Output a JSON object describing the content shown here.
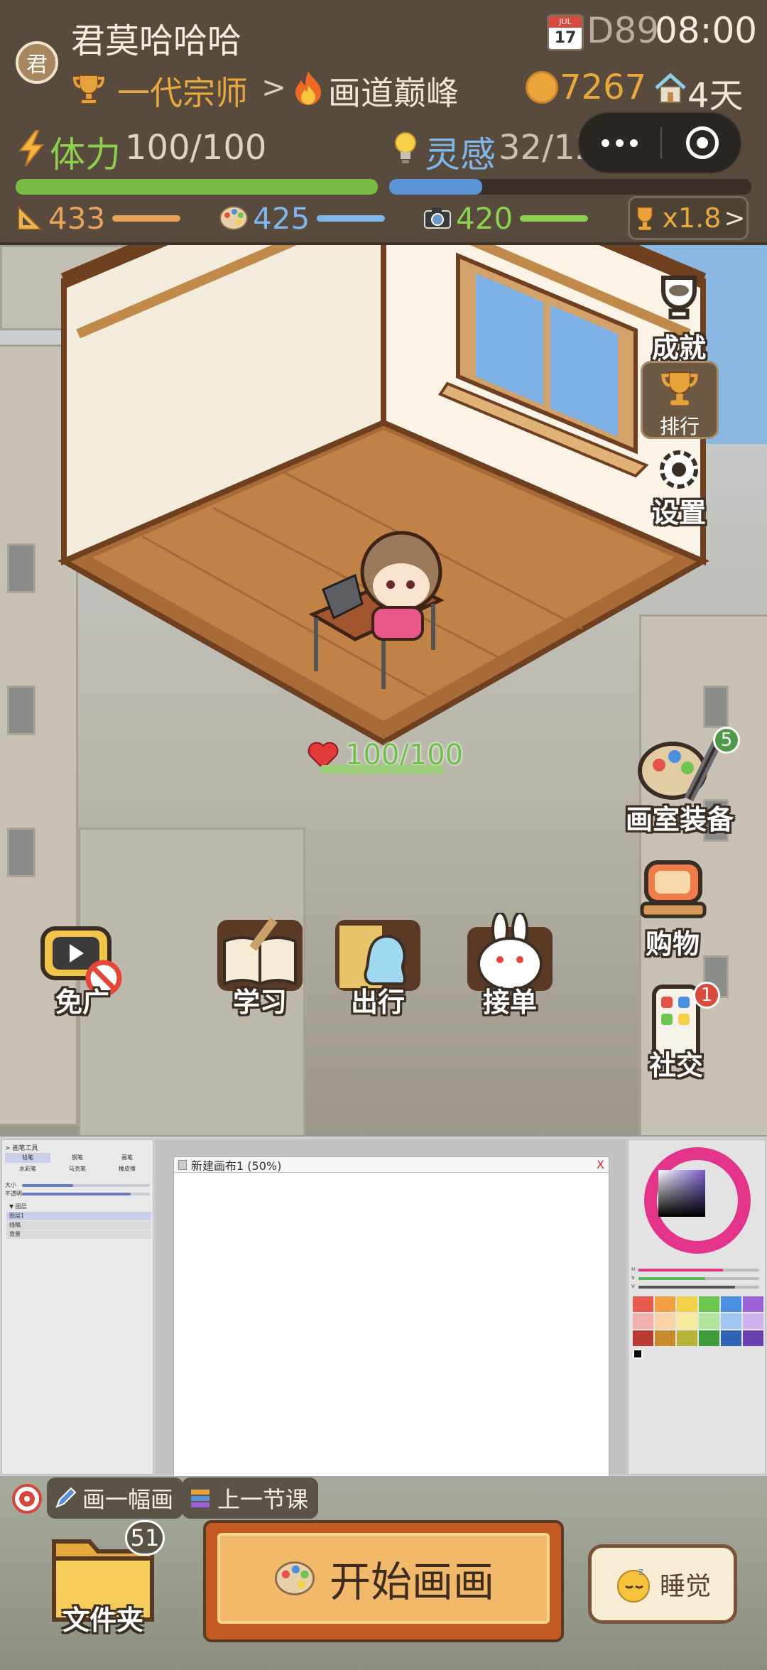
{
  "header": {
    "avatar_char": "君",
    "username": "君莫哈哈哈",
    "rank": "一代宗师",
    "rank_arrow": ">",
    "title": "画道巅峰",
    "calendar_month": "JUL",
    "calendar_day": "17",
    "day": "D89",
    "time": "08:00",
    "coins": "7267",
    "days": "4天",
    "stamina_label": "体力",
    "stamina_value": "100/100",
    "stamina_fraction": 1.0,
    "inspiration_label": "灵感",
    "inspiration_value": "32/125",
    "inspiration_fraction": 0.256,
    "skills": [
      {
        "icon": "ruler-icon",
        "value": "433",
        "color": "#e8a25a"
      },
      {
        "icon": "palette-icon",
        "value": "425",
        "color": "#7fb7ea"
      },
      {
        "icon": "camera-icon",
        "value": "420",
        "color": "#8cd04e"
      }
    ],
    "multiplier": "x1.8",
    "multiplier_chevron": ">",
    "colors": {
      "stamina": "#77bb45",
      "inspiration": "#5b95d6",
      "gold": "#e7a93e"
    }
  },
  "scene": {
    "side_buttons": {
      "achievement": "成就",
      "ranking": "排行",
      "settings": "设置",
      "studio_equipment": "画室装备",
      "studio_badge": "5",
      "shopping": "购物",
      "social": "社交",
      "social_badge": "1"
    },
    "hp": "100/100",
    "actions": [
      {
        "name": "ad-free",
        "label": "免广"
      },
      {
        "name": "study",
        "label": "学习"
      },
      {
        "name": "travel",
        "label": "出行"
      },
      {
        "name": "commission",
        "label": "接单"
      }
    ]
  },
  "paint_app": {
    "tool_title": "> 画笔工具",
    "tools": [
      "铅笔",
      "钢笔",
      "画笔",
      "水彩笔",
      "马克笔",
      "橡皮擦"
    ],
    "size_label": "大小",
    "opacity_label": "不透明",
    "layers_header": "▼ 图层",
    "layers": [
      "图层1",
      "线稿",
      "背景"
    ],
    "canvas_title": "新建画布1 (50%)",
    "canvas_close": "X",
    "hsv_labels": [
      "H",
      "S",
      "V"
    ],
    "swatches": [
      "#e95a4e",
      "#f2a043",
      "#f3d24a",
      "#6cc54e",
      "#4b8fe0",
      "#9b62d8",
      "#f2b1ad",
      "#f7d3a5",
      "#f8ec9c",
      "#b2e49d",
      "#9fc7f2",
      "#cfb2ee",
      "#b83a32",
      "#c98a2c",
      "#b8b338",
      "#3f9b3a",
      "#2f63b6",
      "#6a40b0"
    ]
  },
  "bottom_bar": {
    "quest1": "画一幅画",
    "quest2": "上一节课",
    "folder_label": "文件夹",
    "folder_count": "51",
    "start_label": "开始画画",
    "sleep_label": "睡觉"
  }
}
